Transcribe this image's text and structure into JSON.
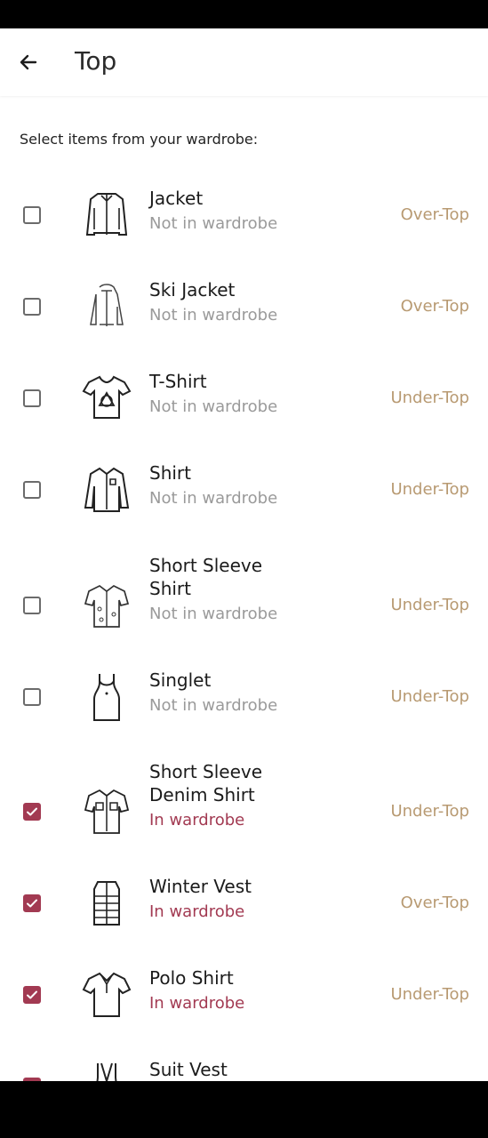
{
  "header": {
    "title": "Top"
  },
  "subtitle": "Select items from your wardrobe:",
  "colors": {
    "accent": "#a23a52",
    "category": "#b89a72",
    "muted": "#9a9a9a"
  },
  "items": [
    {
      "name": "Jacket",
      "status": "Not in wardrobe",
      "category": "Over-Top",
      "checked": false,
      "icon": "jacket-icon"
    },
    {
      "name": "Ski Jacket",
      "status": "Not in wardrobe",
      "category": "Over-Top",
      "checked": false,
      "icon": "ski-jacket-icon"
    },
    {
      "name": "T-Shirt",
      "status": "Not in wardrobe",
      "category": "Under-Top",
      "checked": false,
      "icon": "t-shirt-icon"
    },
    {
      "name": "Shirt",
      "status": "Not in wardrobe",
      "category": "Under-Top",
      "checked": false,
      "icon": "shirt-icon"
    },
    {
      "name": "Short Sleeve Shirt",
      "status": "Not in wardrobe",
      "category": "Under-Top",
      "checked": false,
      "icon": "short-sleeve-shirt-icon"
    },
    {
      "name": "Singlet",
      "status": "Not in wardrobe",
      "category": "Under-Top",
      "checked": false,
      "icon": "singlet-icon"
    },
    {
      "name": "Short Sleeve Denim Shirt",
      "status": "In wardrobe",
      "category": "Under-Top",
      "checked": true,
      "icon": "denim-shirt-icon"
    },
    {
      "name": "Winter Vest",
      "status": "In wardrobe",
      "category": "Over-Top",
      "checked": true,
      "icon": "winter-vest-icon"
    },
    {
      "name": "Polo Shirt",
      "status": "In wardrobe",
      "category": "Under-Top",
      "checked": true,
      "icon": "polo-shirt-icon"
    },
    {
      "name": "Suit Vest",
      "status": "",
      "category": "",
      "checked": true,
      "icon": "suit-vest-icon"
    }
  ]
}
